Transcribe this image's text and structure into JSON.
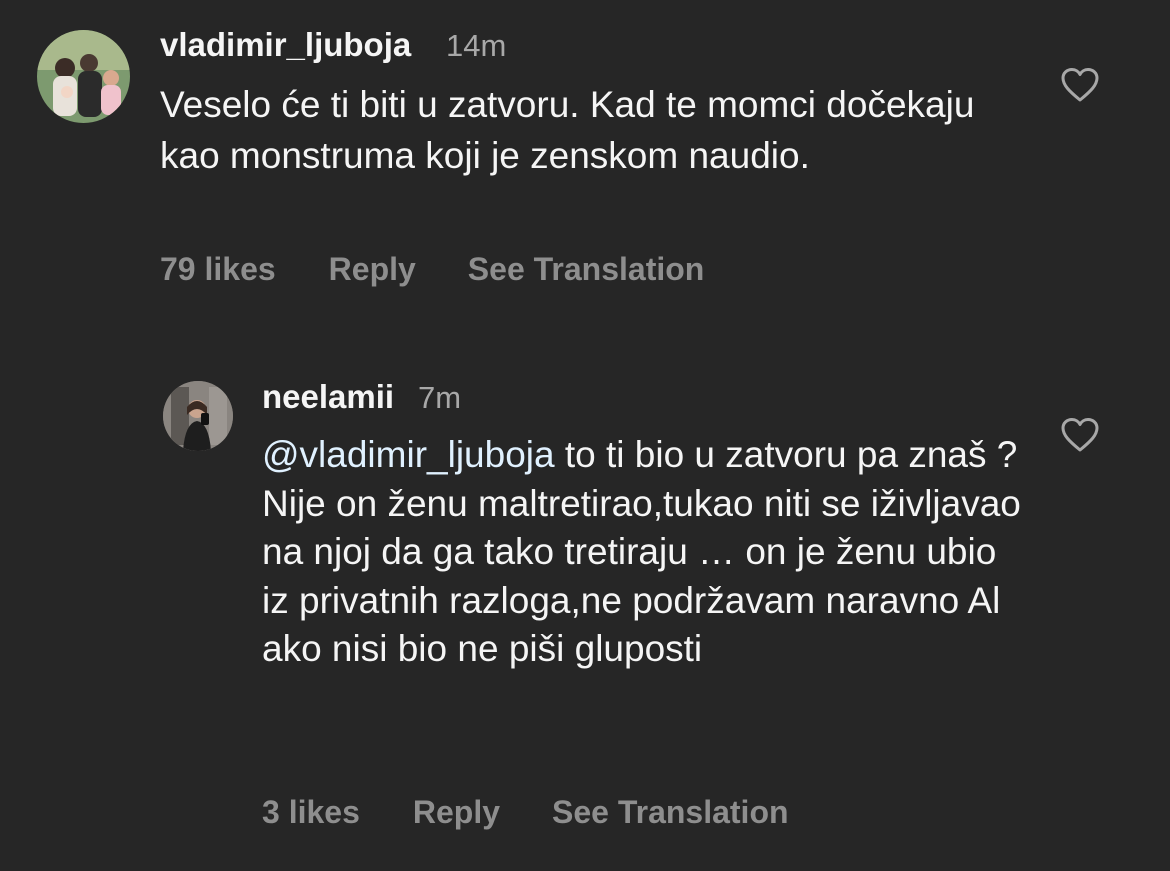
{
  "comments": [
    {
      "username": "vladimir_ljuboja",
      "time": "14m",
      "text": "Veselo će ti biti u zatvoru. Kad te momci dočekaju kao monstruma koji je zenskom naudio.",
      "likes": "79 likes",
      "reply_label": "Reply",
      "translate_label": "See Translation",
      "like_icon": "heart-outline-icon"
    },
    {
      "username": "neelamii",
      "time": "7m",
      "mention": "@vladimir_ljuboja",
      "text": " to ti bio u zatvoru pa znaš ? Nije on ženu maltretirao,tukao niti se iživljavao na njoj da ga tako tretiraju … on je ženu ubio iz privatnih razloga,ne podržavam naravno Al ako nisi bio ne piši gluposti",
      "likes": "3 likes",
      "reply_label": "Reply",
      "translate_label": "See Translation",
      "like_icon": "heart-outline-icon"
    }
  ],
  "colors": {
    "background": "#262626",
    "primary_text": "#f5f5f5",
    "secondary_text": "#a8a8a8",
    "action_text": "#8e8e8e",
    "mention": "#e0f1ff"
  }
}
